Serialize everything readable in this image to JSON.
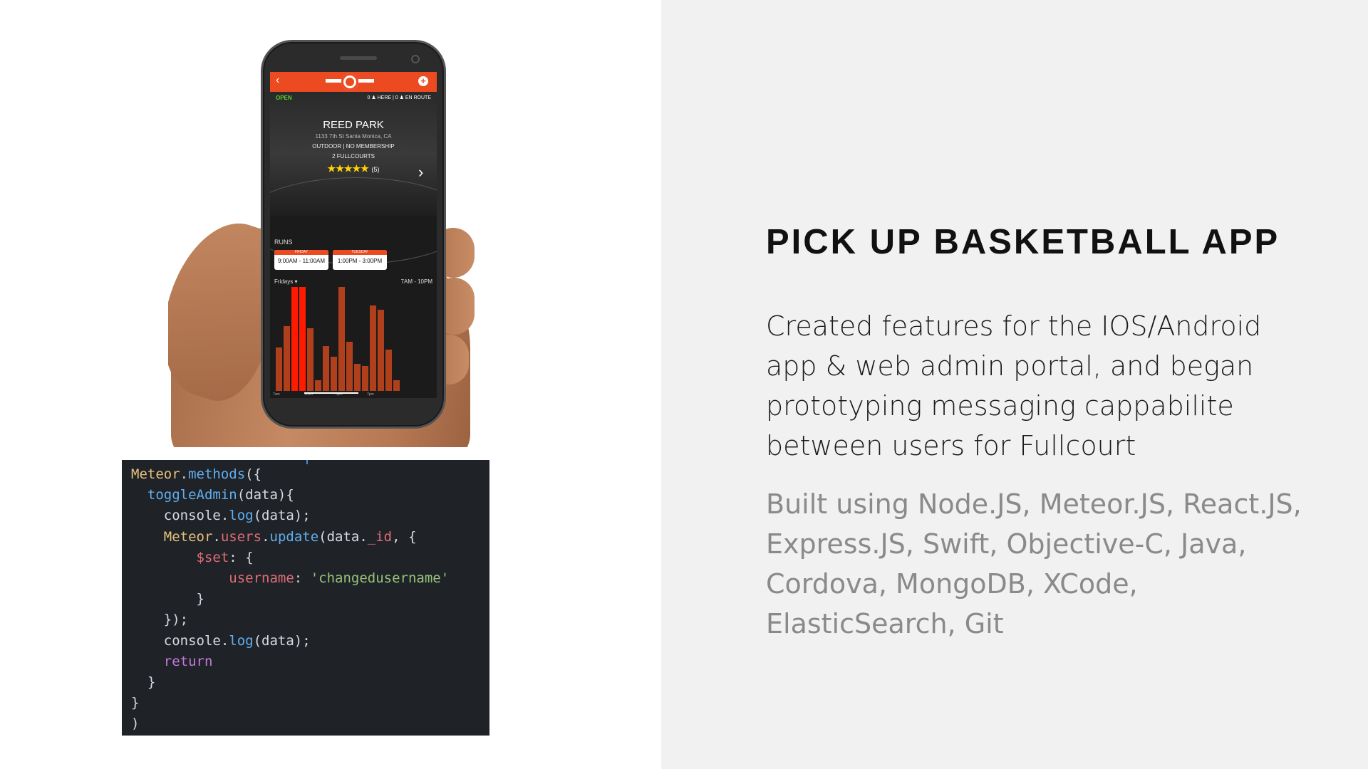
{
  "slide": {
    "title": "PICK UP BASKETBALL APP",
    "description_lines": [
      "Created features for the IOS/Android",
      "app & web admin portal, and  began",
      "prototyping messaging cappabilite",
      "between users for Fullcourt"
    ],
    "tech_lines": [
      "Built using Node.JS, Meteor.JS, React.JS,",
      "Express.JS, Swift, Objective-C, Java,",
      "Cordova, MongoDB, XCode,",
      "ElasticSearch, Git"
    ]
  },
  "phone_app": {
    "status": "OPEN",
    "presence": "0 ♟ HERE | 0 ♟ EN ROUTE",
    "park_name": "REED PARK",
    "address": "1133 7th St Santa Monica, CA",
    "details": "OUTDOOR | NO MEMBERSHIP",
    "courts": "2 FULLCOURTS",
    "rating_stars": "★★★★★",
    "rating_count": "(5)",
    "runs_label": "RUNS",
    "runs": [
      {
        "day": "FRIDAY",
        "time": "9:00AM - 11:00AM"
      },
      {
        "day": "TUESDAY",
        "time": "1:00PM - 3:00PM"
      }
    ],
    "day_selector": "Fridays ▾",
    "hours_range": "7AM - 10PM",
    "x_labels": [
      "7am",
      "11am",
      "3pm",
      "7pm"
    ],
    "activity": [
      0.42,
      0.62,
      1.0,
      1.0,
      0.6,
      0.1,
      0.43,
      0.33,
      1.0,
      0.47,
      0.26,
      0.24,
      0.82,
      0.78,
      0.4,
      0.1
    ],
    "highlight_bars": [
      2,
      3
    ],
    "colors": {
      "brand": "#ec4a21",
      "bar": "#b0401c",
      "bar_highlight": "#ff1a00"
    }
  },
  "code": {
    "lines": [
      [
        {
          "t": "Meteor",
          "c": "yel"
        },
        {
          "t": ".",
          "c": "wht"
        },
        {
          "t": "methods",
          "c": "blu"
        },
        {
          "t": "({",
          "c": "wht"
        }
      ],
      [
        {
          "t": "  ",
          "c": "wht"
        },
        {
          "t": "toggleAdmin",
          "c": "blu"
        },
        {
          "t": "(data){",
          "c": "wht"
        }
      ],
      [
        {
          "t": "    console.",
          "c": "wht"
        },
        {
          "t": "log",
          "c": "blu"
        },
        {
          "t": "(data);",
          "c": "wht"
        }
      ],
      [
        {
          "t": "    ",
          "c": "wht"
        },
        {
          "t": "Meteor",
          "c": "yel"
        },
        {
          "t": ".",
          "c": "wht"
        },
        {
          "t": "users",
          "c": "red"
        },
        {
          "t": ".",
          "c": "wht"
        },
        {
          "t": "update",
          "c": "blu"
        },
        {
          "t": "(data.",
          "c": "wht"
        },
        {
          "t": "_id",
          "c": "red"
        },
        {
          "t": ", {",
          "c": "wht"
        }
      ],
      [
        {
          "t": "        ",
          "c": "wht"
        },
        {
          "t": "$set",
          "c": "red"
        },
        {
          "t": ": {",
          "c": "wht"
        }
      ],
      [
        {
          "t": "            ",
          "c": "wht"
        },
        {
          "t": "username",
          "c": "red"
        },
        {
          "t": ": ",
          "c": "wht"
        },
        {
          "t": "'changedusername'",
          "c": "grn"
        }
      ],
      [
        {
          "t": "        }",
          "c": "wht"
        }
      ],
      [
        {
          "t": "    });",
          "c": "wht"
        }
      ],
      [
        {
          "t": "    console.",
          "c": "wht"
        },
        {
          "t": "log",
          "c": "blu"
        },
        {
          "t": "(data);",
          "c": "wht"
        }
      ],
      [
        {
          "t": "    ",
          "c": "wht"
        },
        {
          "t": "return",
          "c": "pur"
        }
      ],
      [
        {
          "t": "  }",
          "c": "wht"
        }
      ],
      [
        {
          "t": "}",
          "c": "wht"
        }
      ],
      [
        {
          "t": ")",
          "c": "wht"
        }
      ]
    ]
  }
}
